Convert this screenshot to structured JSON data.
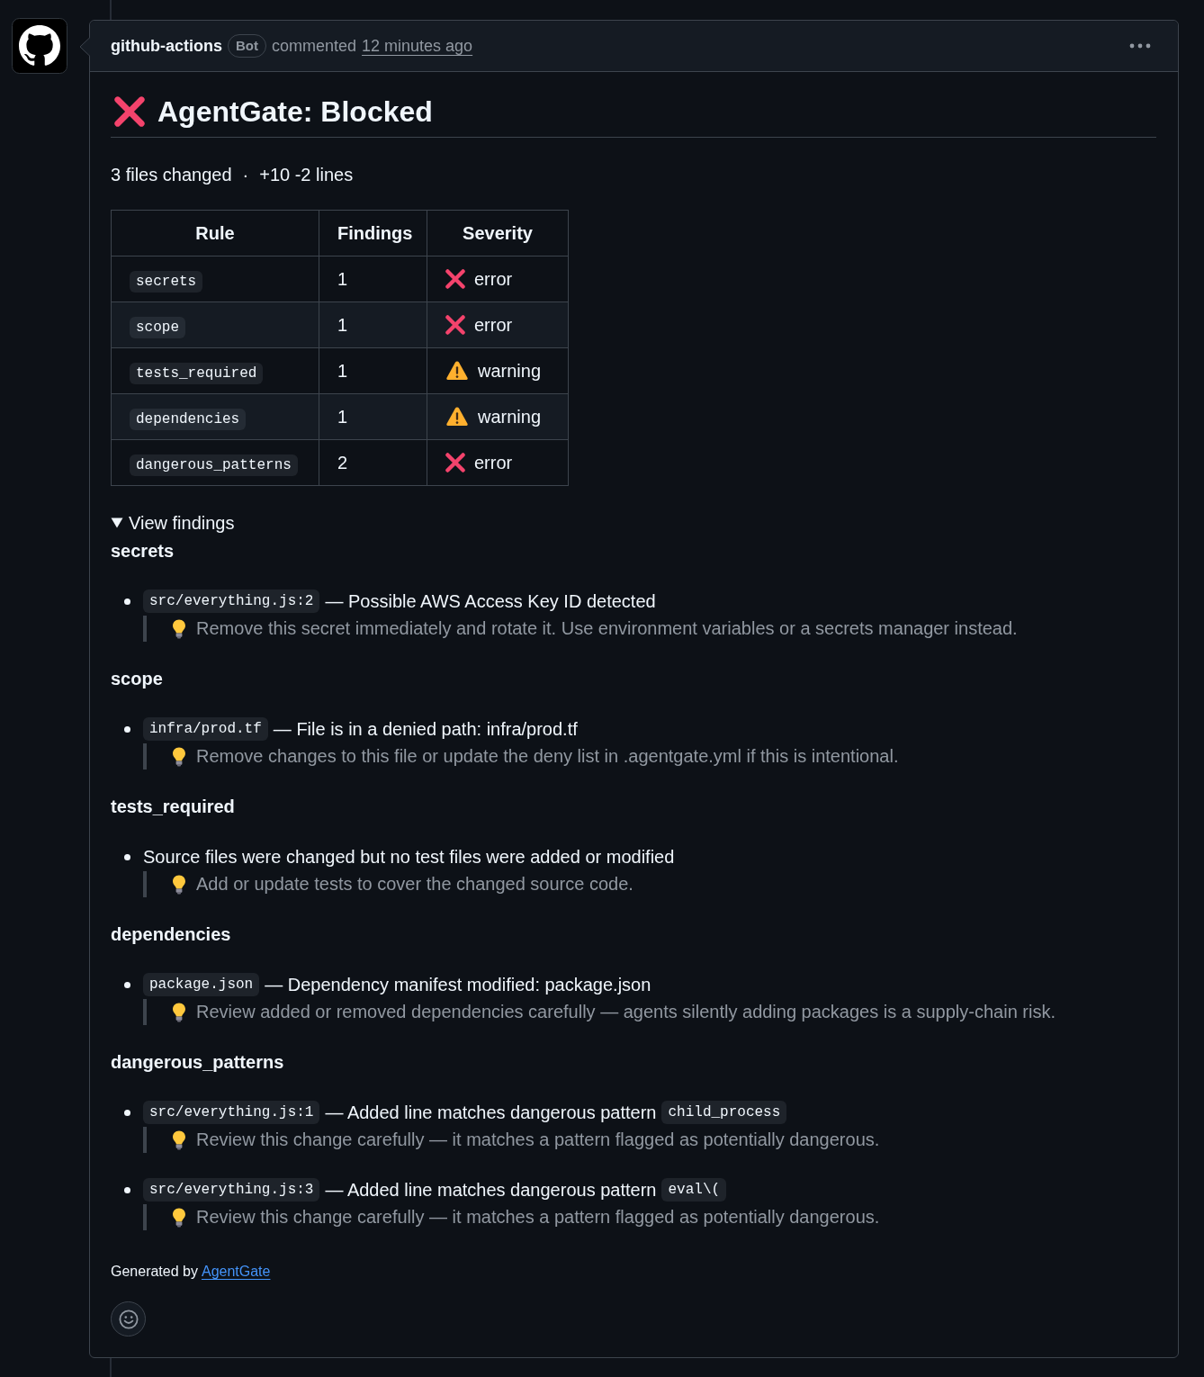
{
  "comment": {
    "author": "github-actions",
    "badge": "Bot",
    "action": "commented",
    "time": "12 minutes ago"
  },
  "report": {
    "kind": "error",
    "title": "AgentGate: Blocked"
  },
  "summary": {
    "files": "3 files changed",
    "separator": "·",
    "lines": "+10 -2 lines"
  },
  "table": {
    "columns": [
      "Rule",
      "Findings",
      "Severity"
    ],
    "rows": [
      {
        "rule": "secrets",
        "findings": "1",
        "kind": "error",
        "severity": "error"
      },
      {
        "rule": "scope",
        "findings": "1",
        "kind": "error",
        "severity": "error"
      },
      {
        "rule": "tests_required",
        "findings": "1",
        "kind": "warning",
        "severity": "warning"
      },
      {
        "rule": "dependencies",
        "findings": "1",
        "kind": "warning",
        "severity": "warning"
      },
      {
        "rule": "dangerous_patterns",
        "findings": "2",
        "kind": "error",
        "severity": "error"
      }
    ]
  },
  "details": {
    "summary": "View findings",
    "expanded": true,
    "sections": [
      {
        "heading": "secrets",
        "items": [
          {
            "file": "src/everything.js:2",
            "message": "— Possible AWS Access Key ID detected",
            "hint": "Remove this secret immediately and rotate it. Use environment variables or a secrets manager instead."
          }
        ]
      },
      {
        "heading": "scope",
        "items": [
          {
            "file": "infra/prod.tf",
            "message": "— File is in a denied path: infra/prod.tf",
            "hint": "Remove changes to this file or update the deny list in .agentgate.yml if this is intentional."
          }
        ]
      },
      {
        "heading": "tests_required",
        "items": [
          {
            "message": "Source files were changed but no test files were added or modified",
            "hint": "Add or update tests to cover the changed source code."
          }
        ]
      },
      {
        "heading": "dependencies",
        "items": [
          {
            "file": "package.json",
            "message": "— Dependency manifest modified: package.json",
            "hint": "Review added or removed dependencies carefully — agents silently adding packages is a supply-chain risk."
          }
        ]
      },
      {
        "heading": "dangerous_patterns",
        "items": [
          {
            "file": "src/everything.js:1",
            "message": "— Added line matches dangerous pattern",
            "pattern": "child_process",
            "hint": "Review this change carefully — it matches a pattern flagged as potentially dangerous."
          },
          {
            "file": "src/everything.js:3",
            "message": "— Added line matches dangerous pattern",
            "pattern": "eval\\(",
            "hint": "Review this change carefully — it matches a pattern flagged as potentially dangerous."
          }
        ]
      }
    ]
  },
  "footer": {
    "text": "Generated by",
    "link": "AgentGate"
  }
}
